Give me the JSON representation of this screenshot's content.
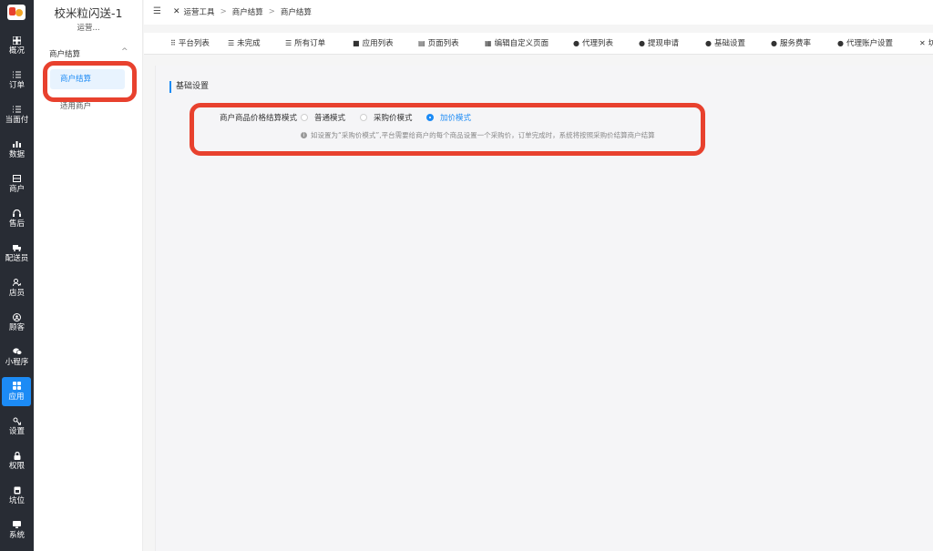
{
  "nav": {
    "items": [
      {
        "label": "概况",
        "icon": "overview-icon"
      },
      {
        "label": "订单",
        "icon": "list-icon"
      },
      {
        "label": "当面付",
        "icon": "list-icon"
      },
      {
        "label": "数据",
        "icon": "bar-chart-icon"
      },
      {
        "label": "商户",
        "icon": "store-icon"
      },
      {
        "label": "售后",
        "icon": "headset-icon"
      },
      {
        "label": "配送员",
        "icon": "truck-icon"
      },
      {
        "label": "店员",
        "icon": "staff-icon"
      },
      {
        "label": "顾客",
        "icon": "customer-icon"
      },
      {
        "label": "小程序",
        "icon": "wechat-icon"
      },
      {
        "label": "应用",
        "icon": "apps-icon"
      },
      {
        "label": "设置",
        "icon": "settings-icon"
      },
      {
        "label": "权限",
        "icon": "lock-icon"
      },
      {
        "label": "坑位",
        "icon": "slot-icon"
      },
      {
        "label": "系统",
        "icon": "system-icon"
      }
    ],
    "active_label": "应用"
  },
  "sidebar": {
    "store_name": "校米粒闪送-1",
    "role": "运营...",
    "group_label": "商户结算",
    "items": [
      {
        "label": "商户结算"
      },
      {
        "label": "适用商户"
      }
    ]
  },
  "topbar": {
    "breadcrumb": [
      "运营工具",
      "商户结算",
      "商户结算"
    ]
  },
  "tabs": [
    {
      "label": "平台列表",
      "icon": "grid-icon"
    },
    {
      "label": "未完成",
      "icon": "list-icon"
    },
    {
      "label": "所有订单",
      "icon": "list-icon"
    },
    {
      "label": "应用列表",
      "icon": "apps-icon"
    },
    {
      "label": "页面列表",
      "icon": "page-icon"
    },
    {
      "label": "编辑自定义页面",
      "icon": "edit-icon"
    },
    {
      "label": "代理列表",
      "icon": "users-icon"
    },
    {
      "label": "提现申请",
      "icon": "users-icon"
    },
    {
      "label": "基础设置",
      "icon": "users-icon"
    },
    {
      "label": "服务费率",
      "icon": "users-icon"
    },
    {
      "label": "代理账户设置",
      "icon": "users-icon"
    },
    {
      "label": "坊",
      "icon": "tools-icon"
    }
  ],
  "section": {
    "title": "基础设置"
  },
  "form": {
    "field_label": "商户商品价格结算模式",
    "options": [
      "普通模式",
      "采购价模式",
      "加价模式"
    ],
    "selected": "加价模式",
    "hint": "如设置为“采购价模式”,平台需要给商户的每个商品设置一个采购价，订单完成时，系统将按照采购价结算商户结算"
  },
  "colors": {
    "nav_bg": "#282c34",
    "accent": "#1c8bf5",
    "annotation": "#e8412e"
  }
}
